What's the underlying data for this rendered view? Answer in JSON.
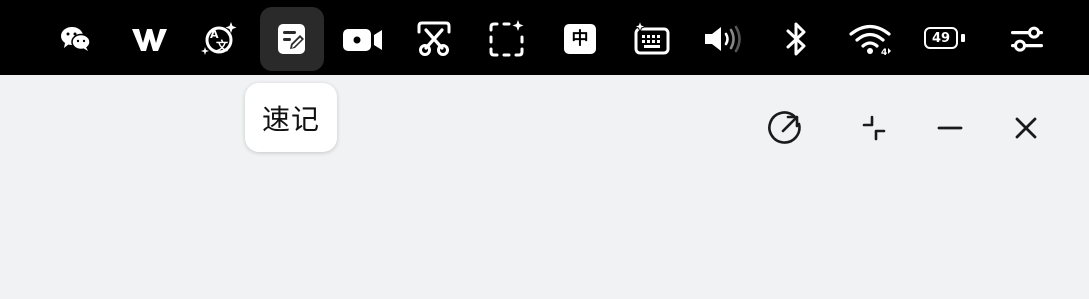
{
  "menubar": {
    "items": [
      {
        "name": "wechat-icon"
      },
      {
        "name": "wps-icon"
      },
      {
        "name": "translate-icon"
      },
      {
        "name": "quick-note-icon",
        "active": true
      },
      {
        "name": "video-record-icon"
      },
      {
        "name": "screenshot-scissors-icon"
      },
      {
        "name": "screen-capture-region-icon"
      },
      {
        "name": "input-method-icon",
        "text": "中"
      },
      {
        "name": "keyboard-ai-icon"
      },
      {
        "name": "volume-icon"
      },
      {
        "name": "bluetooth-icon"
      },
      {
        "name": "wifi-icon"
      },
      {
        "name": "battery-icon",
        "value": "49"
      },
      {
        "name": "control-center-icon"
      }
    ]
  },
  "tooltip": {
    "label": "速记"
  },
  "window_controls": {
    "share": "share-icon",
    "collapse": "collapse-icon",
    "minimize": "minimize-icon",
    "close": "close-icon"
  },
  "colors": {
    "menubar_bg": "#000000",
    "content_bg": "#f1f2f4",
    "icon": "#ffffff"
  }
}
